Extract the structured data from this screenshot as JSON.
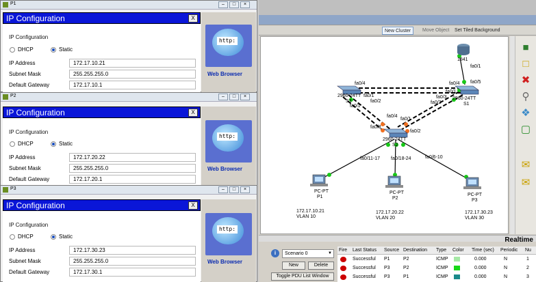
{
  "packet_tracer": {
    "toolbar": {
      "new_cluster": "New Cluster",
      "move_object": "Move Object",
      "set_bg": "Set Tiled Background"
    },
    "realtime": "Realtime",
    "topology": {
      "router": {
        "name": "1841",
        "port": "fa0/1"
      },
      "s1": {
        "name": "2960-24TT",
        "sub": "S1",
        "ports": [
          "fa0/4",
          "fa0/5",
          "fa0/1",
          "fa0/2",
          "fa0/3"
        ]
      },
      "s3": {
        "name": "2960-24TT",
        "sub": "S3",
        "ports": [
          "fa0/4",
          "fa0/1",
          "fa0/2",
          "fa0/1"
        ]
      },
      "s2": {
        "name": "2960-24TT",
        "sub": "S2",
        "ports": [
          "fa0/4",
          "fa0/3",
          "fa0/1",
          "fa0/2"
        ]
      },
      "links": [
        "fa0/11-17",
        "fa0/18-24",
        "fa0/6-10"
      ],
      "pcs": [
        {
          "type": "PC-PT",
          "name": "P1",
          "ip": "172.17.10.21",
          "vlan": "VLAN 10"
        },
        {
          "type": "PC-PT",
          "name": "P2",
          "ip": "172.17.20.22",
          "vlan": "VLAN 20"
        },
        {
          "type": "PC-PT",
          "name": "P3",
          "ip": "172.17.30.23",
          "vlan": "VLAN 30"
        }
      ]
    },
    "scenario": {
      "selected": "Scenario 0",
      "new": "New",
      "delete": "Delete",
      "toggle": "Toggle PDU List Window"
    },
    "pdu_table": {
      "headers": [
        "Fire",
        "Last Status",
        "Source",
        "Destination",
        "Type",
        "Color",
        "Time (sec)",
        "Periodic",
        "Nu"
      ],
      "rows": [
        {
          "status": "Successful",
          "source": "P1",
          "dest": "P2",
          "type": "ICMP",
          "color": "#a6e8a6",
          "time": "0.000",
          "periodic": "N",
          "num": "1"
        },
        {
          "status": "Successful",
          "source": "P3",
          "dest": "P2",
          "type": "ICMP",
          "color": "#18d818",
          "time": "0.000",
          "periodic": "N",
          "num": "2"
        },
        {
          "status": "Successful",
          "source": "P3",
          "dest": "P1",
          "type": "ICMP",
          "color": "#1a8a8a",
          "time": "0.000",
          "periodic": "N",
          "num": "3"
        }
      ]
    }
  },
  "windows": [
    {
      "title": "P1",
      "panel_title": "IP Configuration",
      "section": "IP Configuration",
      "dhcp": "DHCP",
      "static": "Static",
      "labels": {
        "ip": "IP Address",
        "mask": "Subnet Mask",
        "gw": "Default Gateway"
      },
      "values": {
        "ip": "172.17.10.21",
        "mask": "255.255.255.0",
        "gw": "172.17.10.1"
      },
      "close": "X",
      "browser": "Web Browser",
      "http": "http:"
    },
    {
      "title": "P2",
      "panel_title": "IP Configuration",
      "section": "IP Configuration",
      "dhcp": "DHCP",
      "static": "Static",
      "labels": {
        "ip": "IP Address",
        "mask": "Subnet Mask",
        "gw": "Default Gateway"
      },
      "values": {
        "ip": "172.17.20.22",
        "mask": "255.255.255.0",
        "gw": "172.17.20.1"
      },
      "close": "X",
      "browser": "Web Browser",
      "http": "http:"
    },
    {
      "title": "P3",
      "panel_title": "IP Configuration",
      "section": "IP Configuration",
      "dhcp": "DHCP",
      "static": "Static",
      "labels": {
        "ip": "IP Address",
        "mask": "Subnet Mask",
        "gw": "Default Gateway"
      },
      "values": {
        "ip": "172.17.30.23",
        "mask": "255.255.255.0",
        "gw": "172.17.30.1"
      },
      "close": "X",
      "browser": "Web Browser",
      "http": "http:"
    }
  ]
}
